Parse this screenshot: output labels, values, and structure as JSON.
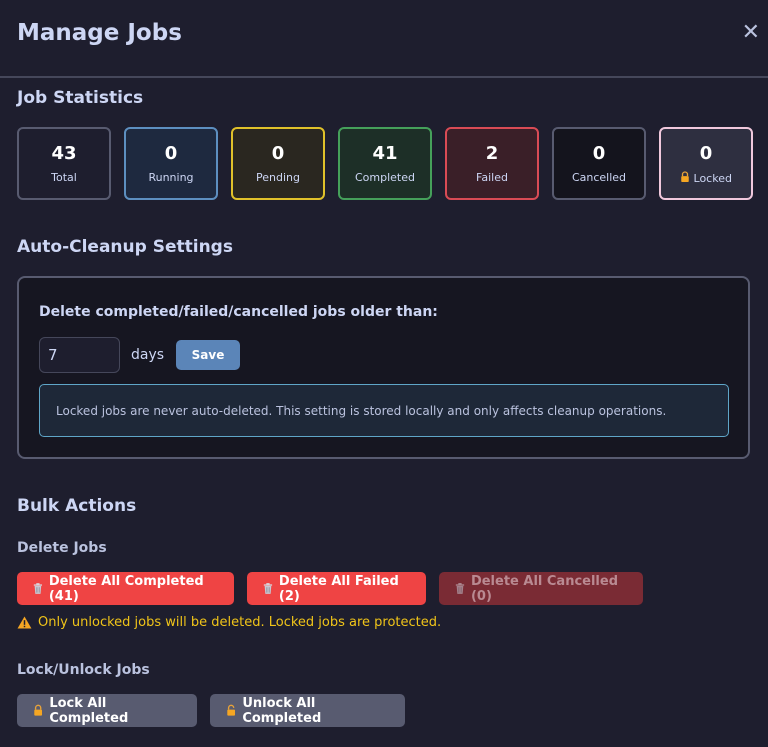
{
  "header": {
    "title": "Manage Jobs",
    "close_glyph": "✕"
  },
  "stats_section": {
    "title": "Job Statistics",
    "stats": [
      {
        "value": "43",
        "label": "Total"
      },
      {
        "value": "0",
        "label": "Running"
      },
      {
        "value": "0",
        "label": "Pending"
      },
      {
        "value": "41",
        "label": "Completed"
      },
      {
        "value": "2",
        "label": "Failed"
      },
      {
        "value": "0",
        "label": "Cancelled"
      },
      {
        "value": "0",
        "label": "Locked"
      }
    ]
  },
  "cleanup": {
    "title": "Auto-Cleanup Settings",
    "label": "Delete completed/failed/cancelled jobs older than:",
    "days_value": "7",
    "days_unit": "days",
    "save_label": "Save",
    "info": "Locked jobs are never auto-deleted. This setting is stored locally and only affects cleanup operations."
  },
  "bulk": {
    "title": "Bulk Actions",
    "delete_heading": "Delete Jobs",
    "delete_completed": "Delete All Completed (41)",
    "delete_failed": "Delete All Failed (2)",
    "delete_cancelled": "Delete All Cancelled (0)",
    "warning": "Only unlocked jobs will be deleted. Locked jobs are protected.",
    "lock_heading": "Lock/Unlock Jobs",
    "lock_completed": "Lock All Completed",
    "unlock_completed": "Unlock All Completed"
  },
  "colors": {
    "background": "#1e1e2e",
    "danger": "#ef4444",
    "accent": "#5b85b8",
    "warning": "#f0c419"
  }
}
